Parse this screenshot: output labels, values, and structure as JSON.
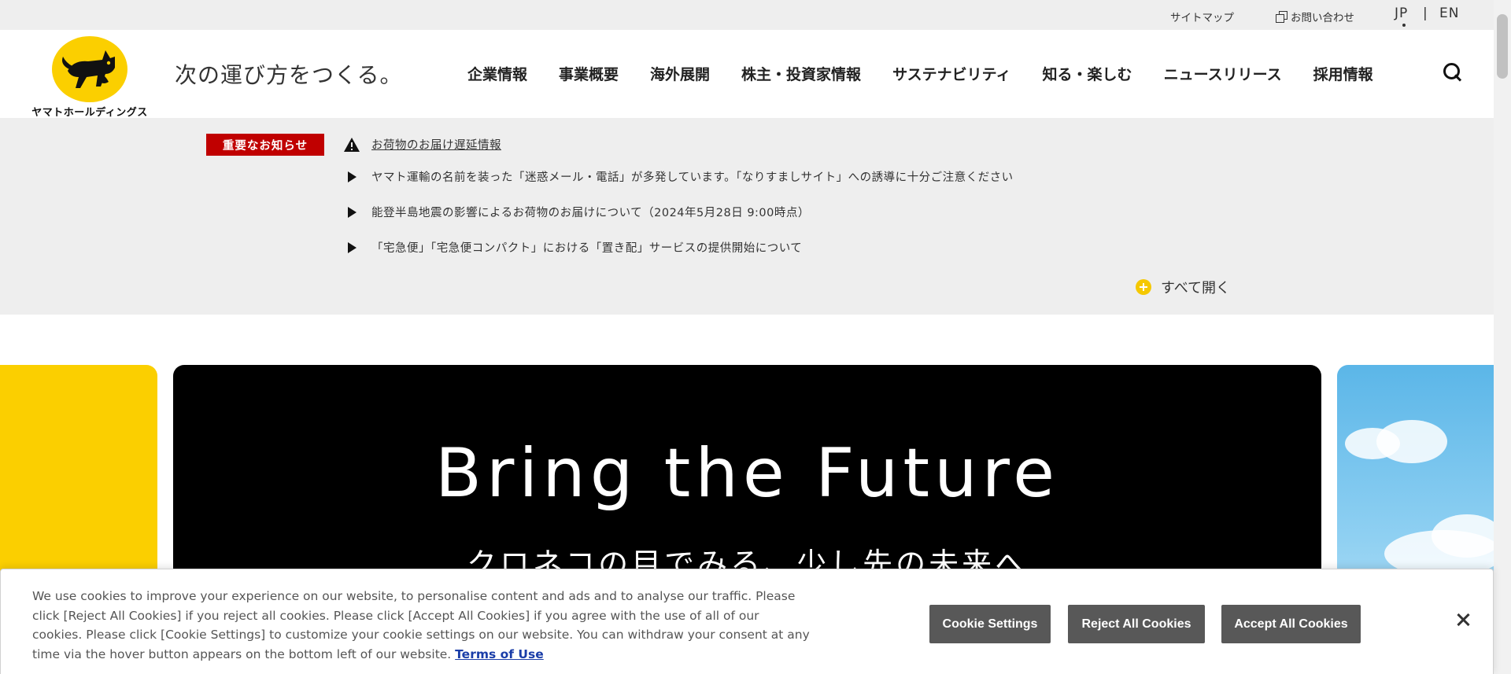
{
  "topbar": {
    "sitemap": "サイトマップ",
    "contact": "お問い合わせ",
    "lang_jp": "JP",
    "lang_sep": "|",
    "lang_en": "EN"
  },
  "header": {
    "logo_text": "ヤマトホールディングス",
    "tagline": "次の運び方をつくる。",
    "nav": [
      "企業情報",
      "事業概要",
      "海外展開",
      "株主・投資家情報",
      "サステナビリティ",
      "知る・楽しむ",
      "ニュースリリース",
      "採用情報"
    ]
  },
  "notice": {
    "label": "重要なお知らせ",
    "items": [
      "お荷物のお届け遅延情報",
      "ヤマト運輸の名前を装った「迷惑メール・電話」が多発しています。「なりすましサイト」への誘導に十分ご注意ください",
      "能登半島地震の影響によるお荷物のお届けについて（2024年5月28日 9:00時点）",
      "「宅急便」「宅急便コンパクト」における「置き配」サービスの提供開始について"
    ],
    "open_all": "すべて開く"
  },
  "hero": {
    "title": "Bring the Future",
    "subtitle": "クロネコの目でみる、少し先の未来へ"
  },
  "cookie": {
    "text": "We use cookies to improve your experience on our website, to personalise content and ads and to analyse our traffic. Please click [Reject All Cookies] if you reject all cookies. Please click [Accept All Cookies] if you agree with the use of all of our cookies. Please click [Cookie Settings] to customize your cookie settings on our website. You can withdraw your consent at any time via the hover button appears on the bottom left of our website.",
    "terms_link": "Terms of Use",
    "settings_button": "Cookie Settings",
    "reject_button": "Reject All Cookies",
    "accept_button": "Accept All Cookies"
  },
  "colors": {
    "brand_yellow": "#fbcf00",
    "notice_red": "#c00000",
    "cookie_button": "#585858"
  }
}
